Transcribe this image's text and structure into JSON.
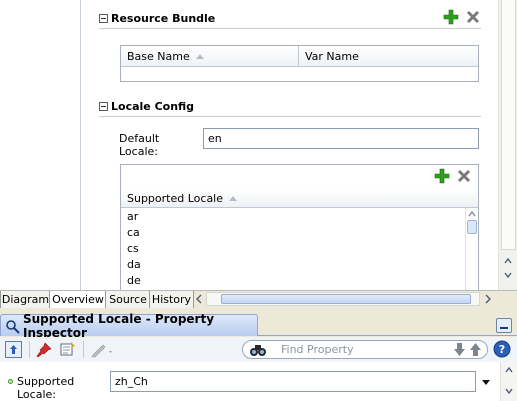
{
  "resource_bundle": {
    "title": "Resource Bundle",
    "columns": [
      "Base Name",
      "Var Name"
    ]
  },
  "locale_config": {
    "title": "Locale Config",
    "default_locale_label": "Default Locale:",
    "default_locale_value": "en",
    "supported_locale_header": "Supported Locale",
    "supported_locales": [
      "ar",
      "ca",
      "cs",
      "da",
      "de"
    ]
  },
  "editor_tabs": [
    "Diagram",
    "Overview",
    "Source",
    "History"
  ],
  "active_editor_tab": "Overview",
  "property_inspector": {
    "title": "Supported Locale - Property Inspector",
    "find_placeholder": "Find Property",
    "field_label": "Supported Locale:",
    "field_value": "zh_Ch"
  },
  "colors": {
    "add_green": "#2e9e1e",
    "delete_gray": "#7a7a7a",
    "pi_header_blue": "#c6d7f3",
    "tab_bar": "#ece9d8"
  },
  "icons": [
    "add-icon",
    "delete-icon",
    "collapse-icon",
    "sort-ascending-icon",
    "scroll-up-icon",
    "scroll-down-icon",
    "scroll-left-icon",
    "scroll-right-icon",
    "binoculars-icon",
    "pin-icon",
    "freeze-icon",
    "edit-pencil-icon",
    "nav-up-icon",
    "help-icon",
    "arrow-down-icon",
    "arrow-up-icon",
    "minimize-icon",
    "dropdown-arrow-icon"
  ]
}
